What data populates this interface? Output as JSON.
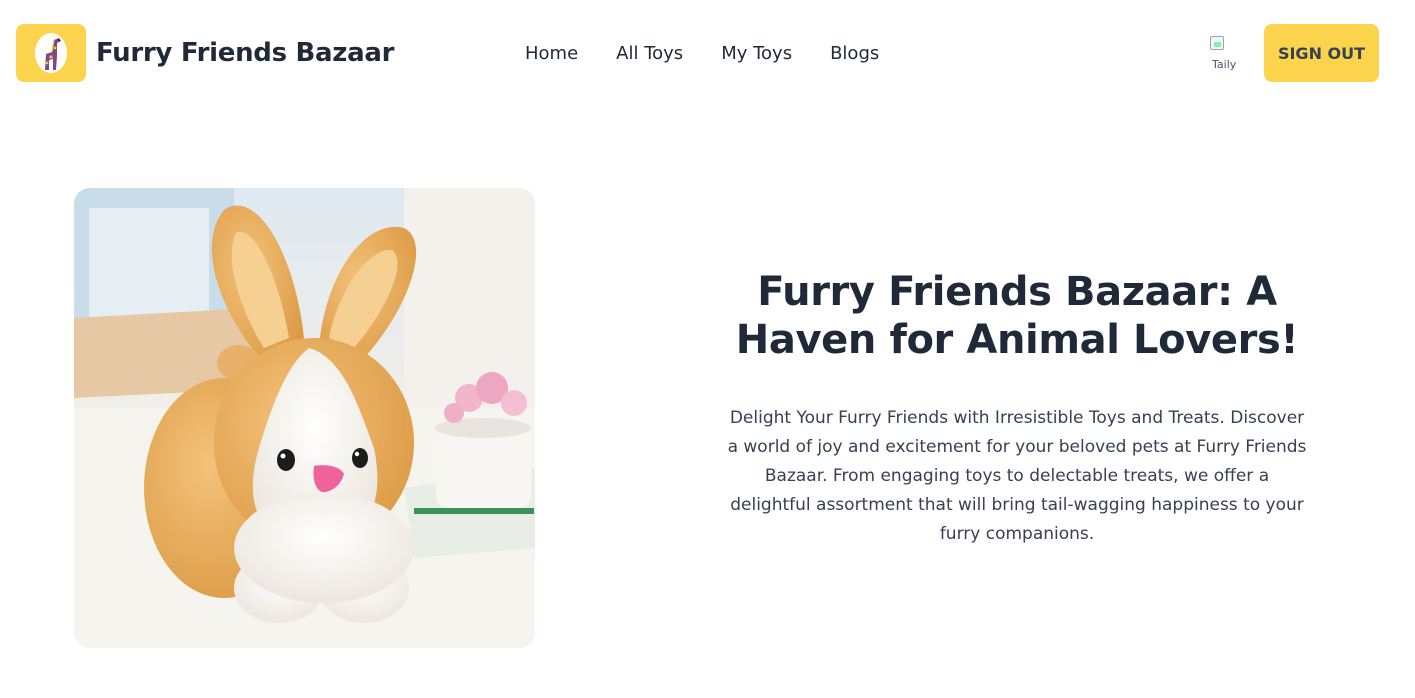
{
  "header": {
    "brand": "Furry Friends Bazaar",
    "logo_icon": "giraffe-toy-icon",
    "nav": [
      "Home",
      "All Toys",
      "My Toys",
      "Blogs"
    ],
    "avatar_alt": "Taily",
    "sign_out_label": "SIGN OUT"
  },
  "hero": {
    "image_subject": "plush-bunny-toy",
    "title": "Furry Friends Bazaar: A Haven for Animal Lovers!",
    "description": "Delight Your Furry Friends with Irresistible Toys and Treats. Discover a world of joy and excitement for your beloved pets at Furry Friends Bazaar. From engaging toys to delectable treats, we offer a delightful assortment that will bring tail-wagging happiness to your furry companions."
  },
  "colors": {
    "accent": "#fcd34d",
    "text": "#1f2937",
    "background": "#ffffff"
  }
}
